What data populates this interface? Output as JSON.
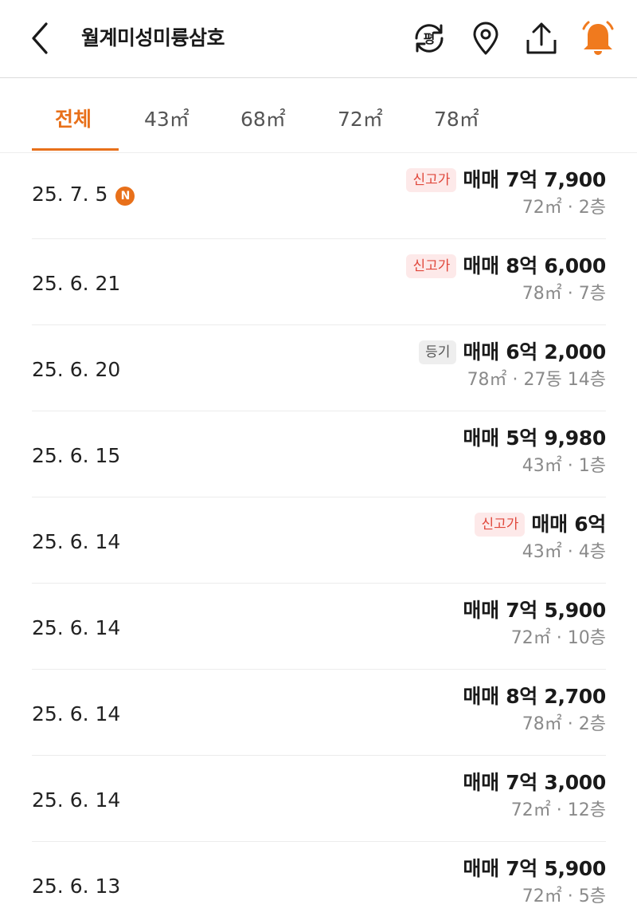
{
  "header": {
    "title": "월계미성미륭삼호",
    "pyeong_label": "평"
  },
  "tabs": [
    {
      "label": "전체",
      "active": true
    },
    {
      "label": "43㎡",
      "active": false
    },
    {
      "label": "68㎡",
      "active": false
    },
    {
      "label": "72㎡",
      "active": false
    },
    {
      "label": "78㎡",
      "active": false
    }
  ],
  "colors": {
    "accent": "#e8701a",
    "badge_red_bg": "#fde9e9",
    "badge_red_text": "#e0483c"
  },
  "transactions": [
    {
      "date": "25. 7. 5",
      "is_new": true,
      "new_label": "N",
      "badge": "신고가",
      "badge_type": "red",
      "price": "매매 7억 7,900",
      "detail": "72㎡ · 2층"
    },
    {
      "date": "25. 6. 21",
      "is_new": false,
      "badge": "신고가",
      "badge_type": "red",
      "price": "매매 8억 6,000",
      "detail": "78㎡ · 7층"
    },
    {
      "date": "25. 6. 20",
      "is_new": false,
      "badge": "등기",
      "badge_type": "gray",
      "price": "매매 6억 2,000",
      "detail": "78㎡ · 27동 14층"
    },
    {
      "date": "25. 6. 15",
      "is_new": false,
      "badge": "",
      "badge_type": "",
      "price": "매매 5억 9,980",
      "detail": "43㎡ · 1층"
    },
    {
      "date": "25. 6. 14",
      "is_new": false,
      "badge": "신고가",
      "badge_type": "red",
      "price": "매매 6억",
      "detail": "43㎡ · 4층"
    },
    {
      "date": "25. 6. 14",
      "is_new": false,
      "badge": "",
      "badge_type": "",
      "price": "매매 7억 5,900",
      "detail": "72㎡ · 10층"
    },
    {
      "date": "25. 6. 14",
      "is_new": false,
      "badge": "",
      "badge_type": "",
      "price": "매매 8억 2,700",
      "detail": "78㎡ · 2층"
    },
    {
      "date": "25. 6. 14",
      "is_new": false,
      "badge": "",
      "badge_type": "",
      "price": "매매 7억 3,000",
      "detail": "72㎡ · 12층"
    },
    {
      "date": "25. 6. 13",
      "is_new": false,
      "badge": "",
      "badge_type": "",
      "price": "매매 7억 5,900",
      "detail": "72㎡ · 5층"
    }
  ]
}
